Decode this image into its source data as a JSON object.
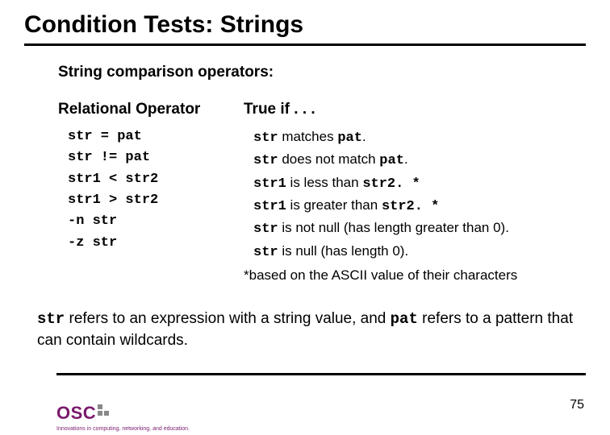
{
  "title": "Condition Tests: Strings",
  "subtitle": "String comparison operators:",
  "columns": {
    "left_head": "Relational Operator",
    "right_head": "True if . . ."
  },
  "rows": [
    {
      "op": "str = pat",
      "desc_pre": "str",
      "desc_mid": " matches ",
      "desc_code": "pat",
      "desc_post": "."
    },
    {
      "op": "str != pat",
      "desc_pre": "str",
      "desc_mid": " does not match ",
      "desc_code": "pat",
      "desc_post": "."
    },
    {
      "op": "str1 < str2",
      "desc_pre": "str1",
      "desc_mid": " is less than ",
      "desc_code": "str2. *",
      "desc_post": ""
    },
    {
      "op": "str1 > str2",
      "desc_pre": "str1",
      "desc_mid": " is greater than ",
      "desc_code": "str2. *",
      "desc_post": ""
    },
    {
      "op": "-n str",
      "desc_pre": "str",
      "desc_mid": " is not null (has length greater than 0).",
      "desc_code": "",
      "desc_post": ""
    },
    {
      "op": "-z str",
      "desc_pre": "str",
      "desc_mid": " is null (has length 0).",
      "desc_code": "",
      "desc_post": ""
    }
  ],
  "footnote": "*based on the ASCII value of their characters",
  "bottom": {
    "code1": "str",
    "text1": " refers to an expression with a string value, and ",
    "code2": "pat",
    "text2": " refers to a pattern that can contain wildcards."
  },
  "logo": {
    "text": "OSC",
    "tagline": "Innovations in computing, networking, and education."
  },
  "page_number": "75"
}
